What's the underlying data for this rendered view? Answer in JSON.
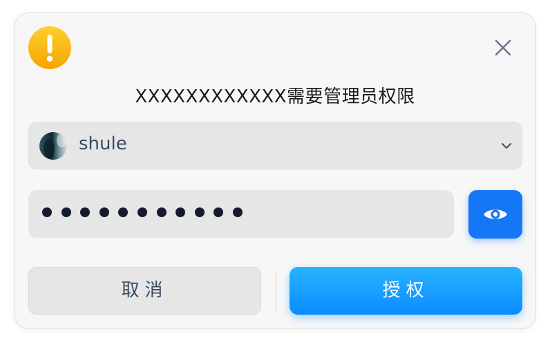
{
  "dialog": {
    "title": "XXXXXXXXXXXX需要管理员权限",
    "icons": {
      "warning": "warning-icon",
      "close": "close-icon",
      "chevron": "chevron-down-icon",
      "eye": "eye-icon"
    },
    "user": {
      "name": "shule",
      "avatar": "avatar"
    },
    "password": {
      "masked_length": 11
    },
    "buttons": {
      "cancel_label": "取消",
      "authorize_label": "授权"
    },
    "colors": {
      "accent": "#1477f8",
      "primary_gradient_top": "#28b4ff",
      "primary_gradient_bottom": "#0a8bff",
      "warning": "#f8b500"
    }
  }
}
